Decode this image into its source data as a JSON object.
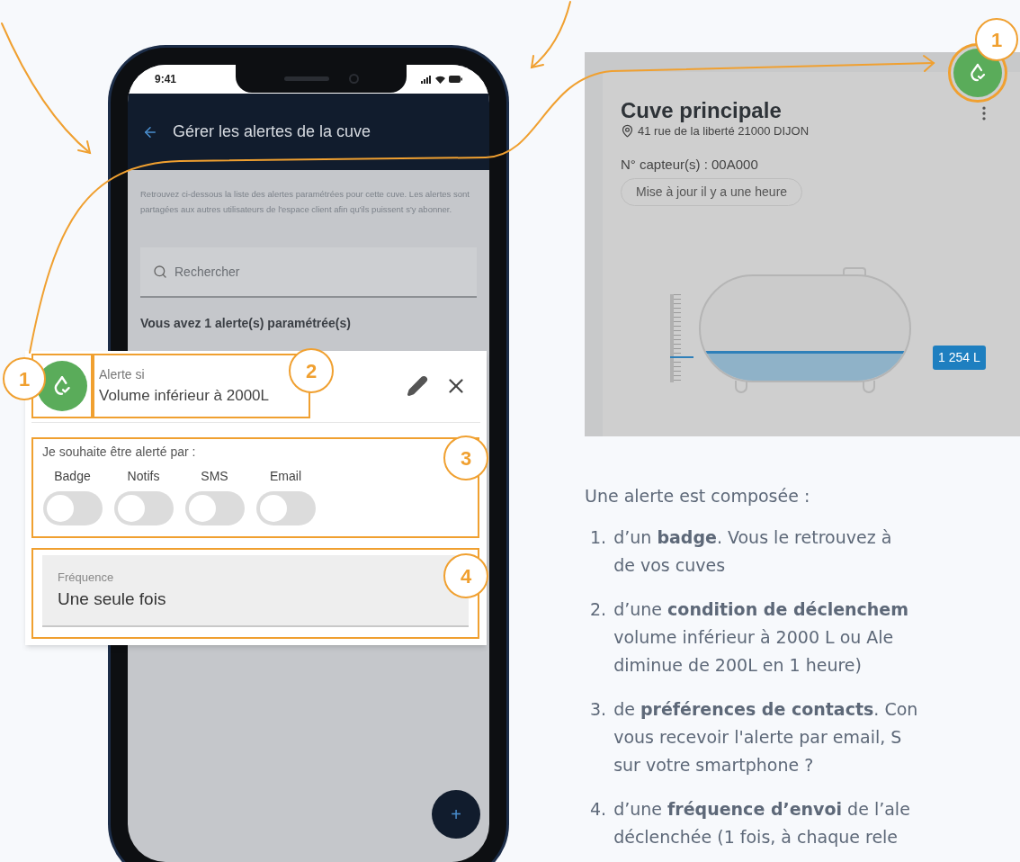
{
  "phone": {
    "status_time": "9:41",
    "header": {
      "title": "Gérer les alertes de la cuve"
    },
    "intro": "Retrouvez ci-dessous la liste des alertes paramétrées pour cette cuve. Les alertes sont partagées aux autres utilisateurs de l'espace client afin qu'ils puissent s'y abonner.",
    "search": {
      "placeholder": "Rechercher"
    },
    "count": "Vous avez 1 alerte(s) paramétrée(s)",
    "fab": "+"
  },
  "alert_popup": {
    "badge_callout": "1",
    "condition": {
      "callout": "2",
      "label": "Alerte si",
      "value": "Volume inférieur à 2000L"
    },
    "contacts": {
      "callout": "3",
      "label": "Je souhaite être alerté par :",
      "channels": [
        {
          "name": "Badge",
          "on": false
        },
        {
          "name": "Notifs",
          "on": false
        },
        {
          "name": "SMS",
          "on": false
        },
        {
          "name": "Email",
          "on": false
        }
      ]
    },
    "frequency": {
      "callout": "4",
      "label": "Fréquence",
      "value": "Une seule fois"
    }
  },
  "tank_card": {
    "badge_callout": "1",
    "title": "Cuve principale",
    "address": "41 rue de la liberté 21000 DIJON",
    "sensor": "N° capteur(s) : 00A000",
    "updated": "Mise à jour il y a une heure",
    "volume": "1 254 L",
    "level": 0.28
  },
  "explanation": {
    "intro": "Une alerte est composée :",
    "items": [
      {
        "number": "1.",
        "lines": [
          "d’un **badge**. Vous le retrouvez à",
          "de vos cuves"
        ]
      },
      {
        "number": "2.",
        "lines": [
          "d’une **condition de déclenchem**",
          "volume inférieur à 2000 L ou Ale",
          "diminue de 200L en 1 heure)"
        ]
      },
      {
        "number": "3.",
        "lines": [
          "de **préférences de contacts**. Con",
          "vous recevoir l'alerte par email, S",
          "sur votre smartphone ?"
        ]
      },
      {
        "number": "4.",
        "lines": [
          "d’une **fréquence d’envoi** de l’ale",
          "déclenchée (1 fois, à chaque rele"
        ]
      }
    ]
  }
}
